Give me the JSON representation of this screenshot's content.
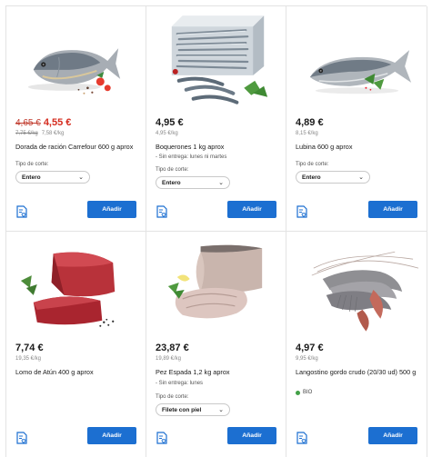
{
  "products": [
    {
      "old_price": "4,65 €",
      "price": "4,55 €",
      "old_unit_price": "7,75 €/kg",
      "unit_price": "7,58 €/kg",
      "name": "Dorada de ración Carrefour 600 g aprox",
      "cut_label": "Tipo de corte:",
      "cut_value": "Entero",
      "add_label": "Añadir"
    },
    {
      "price": "4,95 €",
      "unit_price": "4,95 €/kg",
      "name": "Boquerones 1 kg aprox",
      "delivery": "- Sin entrega: lunes ni martes",
      "cut_label": "Tipo de corte:",
      "cut_value": "Entero",
      "add_label": "Añadir"
    },
    {
      "price": "4,89 €",
      "unit_price": "8,15 €/kg",
      "name": "Lubina 600 g aprox",
      "cut_label": "Tipo de corte:",
      "cut_value": "Entero",
      "add_label": "Añadir"
    },
    {
      "price": "7,74 €",
      "unit_price": "19,35 €/kg",
      "name": "Lomo de Atún 400 g aprox",
      "add_label": "Añadir"
    },
    {
      "price": "23,87 €",
      "unit_price": "19,89 €/kg",
      "name": "Pez Espada 1,2 kg aprox",
      "delivery": "- Sin entrega: lunes",
      "cut_label": "Tipo de corte:",
      "cut_value": "Filete con piel",
      "add_label": "Añadir"
    },
    {
      "price": "4,97 €",
      "unit_price": "9,95 €/kg",
      "name": "Langostino gordo crudo (20/30 ud) 500 g",
      "badge": "BIO",
      "add_label": "Añadir"
    }
  ],
  "colors": {
    "accent": "#1c6fd1",
    "promo": "#d52b1e",
    "bio": "#43a047"
  },
  "icons": {
    "compare": "compare-list-icon",
    "dropdown": "chevron-down-icon"
  }
}
